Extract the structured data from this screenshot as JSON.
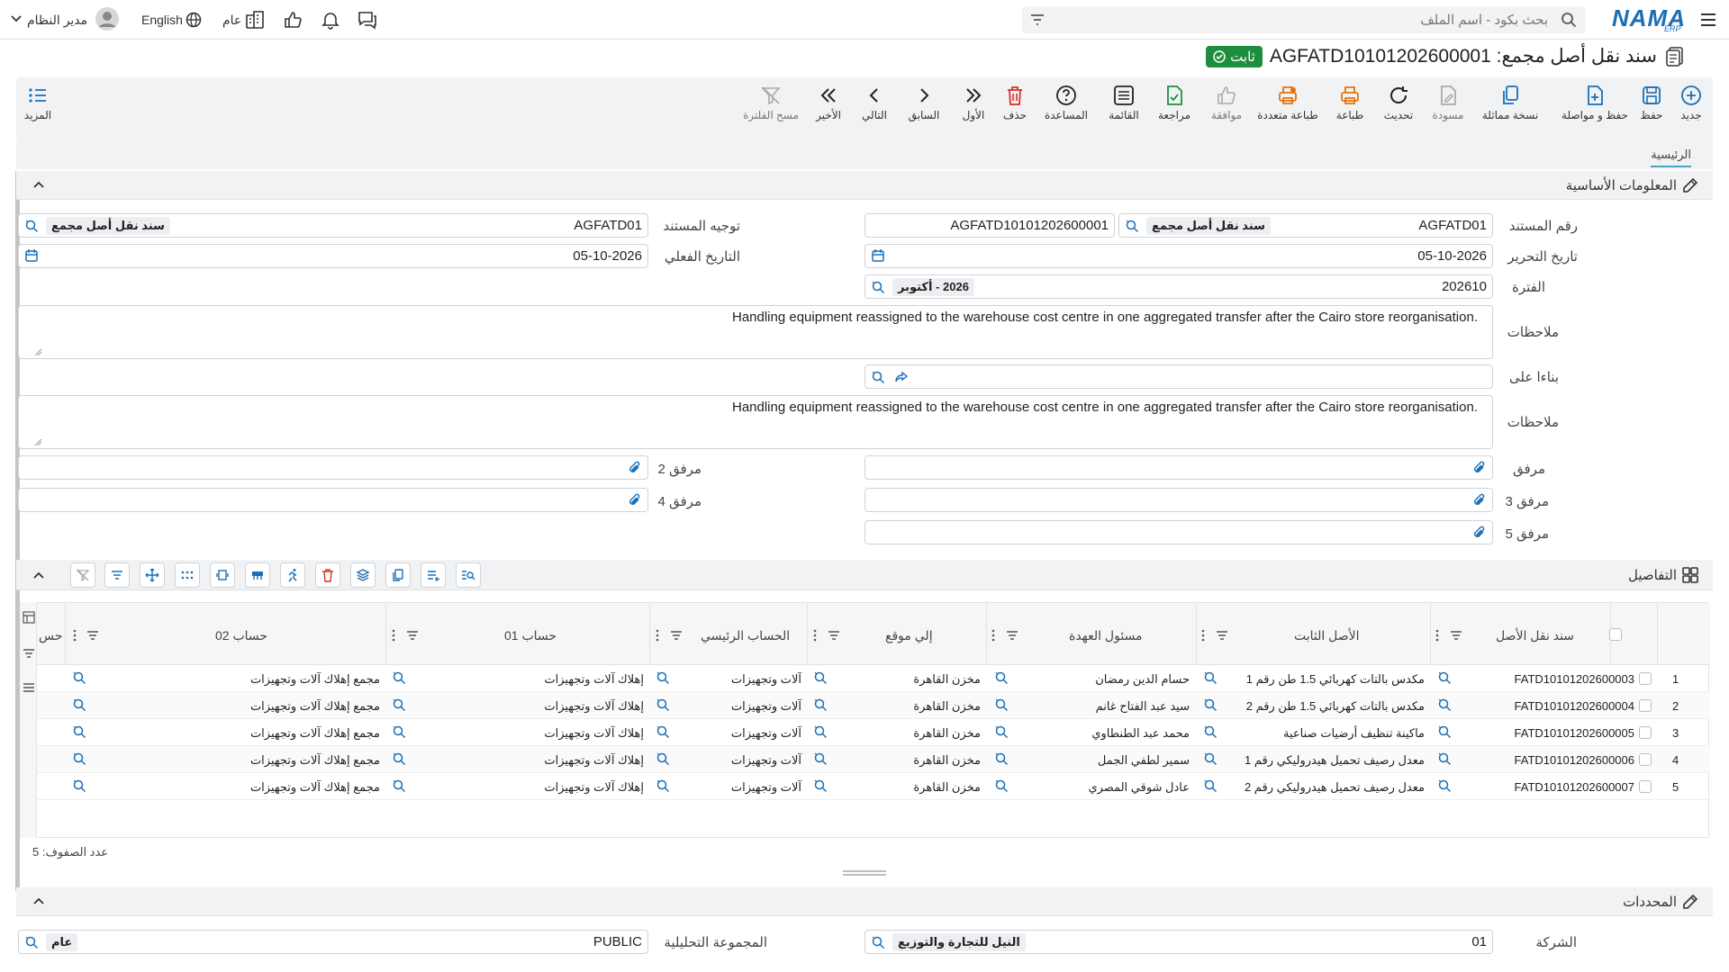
{
  "topbar": {
    "search_placeholder": "بحث بكود - اسم الملف",
    "brand": "NAMA",
    "brand_sub": "ERP",
    "user": "مدير النظام",
    "language": "English",
    "scope": "عام"
  },
  "title": {
    "text": "سند نقل أصل مجمع: AGFATD10101202600001",
    "status": "ثابت"
  },
  "toolbar": {
    "new": "جديد",
    "save": "حفظ",
    "save_continue": "حفظ و مواصلة",
    "duplicate": "نسخة مماثلة",
    "draft": "مسودة",
    "refresh": "تحديث",
    "print": "طباعة",
    "multi_print": "طباعة متعددة",
    "approve": "موافقة",
    "review": "مراجعة",
    "list": "القائمة",
    "help": "المساعدة",
    "delete": "حذف",
    "first": "الأول",
    "prev": "السابق",
    "next": "التالي",
    "last": "الأخير",
    "clear_filter": "مسح الفلترة",
    "more": "المزيد"
  },
  "tabs": {
    "main": "الرئيسية"
  },
  "basic": {
    "section_title": "المعلومات الأساسية",
    "doc_no_label": "رقم المستند",
    "doc_no_value": "AGFATD01",
    "doc_no_chip": "سند نقل أصل مجمع",
    "doc_code": "AGFATD10101202600001",
    "direction_label": "توجيه المستند",
    "direction_value": "AGFATD01",
    "direction_chip": "سند نقل أصل مجمع",
    "date_label": "تاريخ التحرير",
    "date_value": "05-10-2026",
    "actual_date_label": "التاريخ الفعلي",
    "actual_date_value": "05-10-2026",
    "period_label": "الفترة",
    "period_value": "202610",
    "period_chip": "2026 - أكتوبر",
    "notes_label": "ملاحظات",
    "notes_value": "Handling equipment reassigned to the warehouse cost centre in one aggregated transfer after the Cairo store reorganisation.",
    "based_on_label": "بناءا على",
    "notes2_label": "ملاحظات",
    "notes2_value": "Handling equipment reassigned to the warehouse cost centre in one aggregated transfer after the Cairo store reorganisation.",
    "att1": "مرفق",
    "att2": "مرفق 2",
    "att3": "مرفق 3",
    "att4": "مرفق 4",
    "att5": "مرفق 5"
  },
  "details": {
    "section_title": "التفاصيل",
    "columns": [
      "سند نقل الأصل",
      "الأصل الثابت",
      "مسئول العهدة",
      "إلي موقع",
      "الحساب الرئيسي",
      "حساب 01",
      "حساب 02",
      "حس"
    ],
    "rows": [
      {
        "n": "1",
        "doc": "FATD10101202600003",
        "asset": "مكدس بالتات كهربائي 1.5 طن رقم 1",
        "custodian": "حسام الدين رمضان",
        "to": "مخزن القاهرة",
        "main": "آلات وتجهيزات",
        "acc1": "إهلاك آلات وتجهيزات",
        "acc2": "مجمع إهلاك آلات وتجهيزات"
      },
      {
        "n": "2",
        "doc": "FATD10101202600004",
        "asset": "مكدس بالتات كهربائي 1.5 طن رقم 2",
        "custodian": "سيد عبد الفتاح غانم",
        "to": "مخزن القاهرة",
        "main": "آلات وتجهيزات",
        "acc1": "إهلاك آلات وتجهيزات",
        "acc2": "مجمع إهلاك آلات وتجهيزات"
      },
      {
        "n": "3",
        "doc": "FATD10101202600005",
        "asset": "ماكينة تنظيف أرضيات صناعية",
        "custodian": "محمد عبد الطنطاوي",
        "to": "مخزن القاهرة",
        "main": "آلات وتجهيزات",
        "acc1": "إهلاك آلات وتجهيزات",
        "acc2": "مجمع إهلاك آلات وتجهيزات"
      },
      {
        "n": "4",
        "doc": "FATD10101202600006",
        "asset": "معدل رصيف تحميل هيدروليكي رقم 1",
        "custodian": "سمير لطفي الجمل",
        "to": "مخزن القاهرة",
        "main": "آلات وتجهيزات",
        "acc1": "إهلاك آلات وتجهيزات",
        "acc2": "مجمع إهلاك آلات وتجهيزات"
      },
      {
        "n": "5",
        "doc": "FATD10101202600007",
        "asset": "معدل رصيف تحميل هيدروليكي رقم 2",
        "custodian": "عادل شوقي المصري",
        "to": "مخزن القاهرة",
        "main": "آلات وتجهيزات",
        "acc1": "إهلاك آلات وتجهيزات",
        "acc2": "مجمع إهلاك آلات وتجهيزات"
      }
    ],
    "row_count": "عدد الصفوف: 5"
  },
  "dims": {
    "section_title": "المحددات",
    "company_label": "الشركة",
    "company_value": "01",
    "company_chip": "النيل للتجارة والتوزيع",
    "analytic_label": "المجموعة التحليلية",
    "analytic_value": "PUBLIC",
    "analytic_chip": "عام"
  },
  "colors": {
    "accent": "#1b6fb5",
    "green": "#1e8e3e",
    "red": "#d93025",
    "orange": "#e8710a"
  }
}
